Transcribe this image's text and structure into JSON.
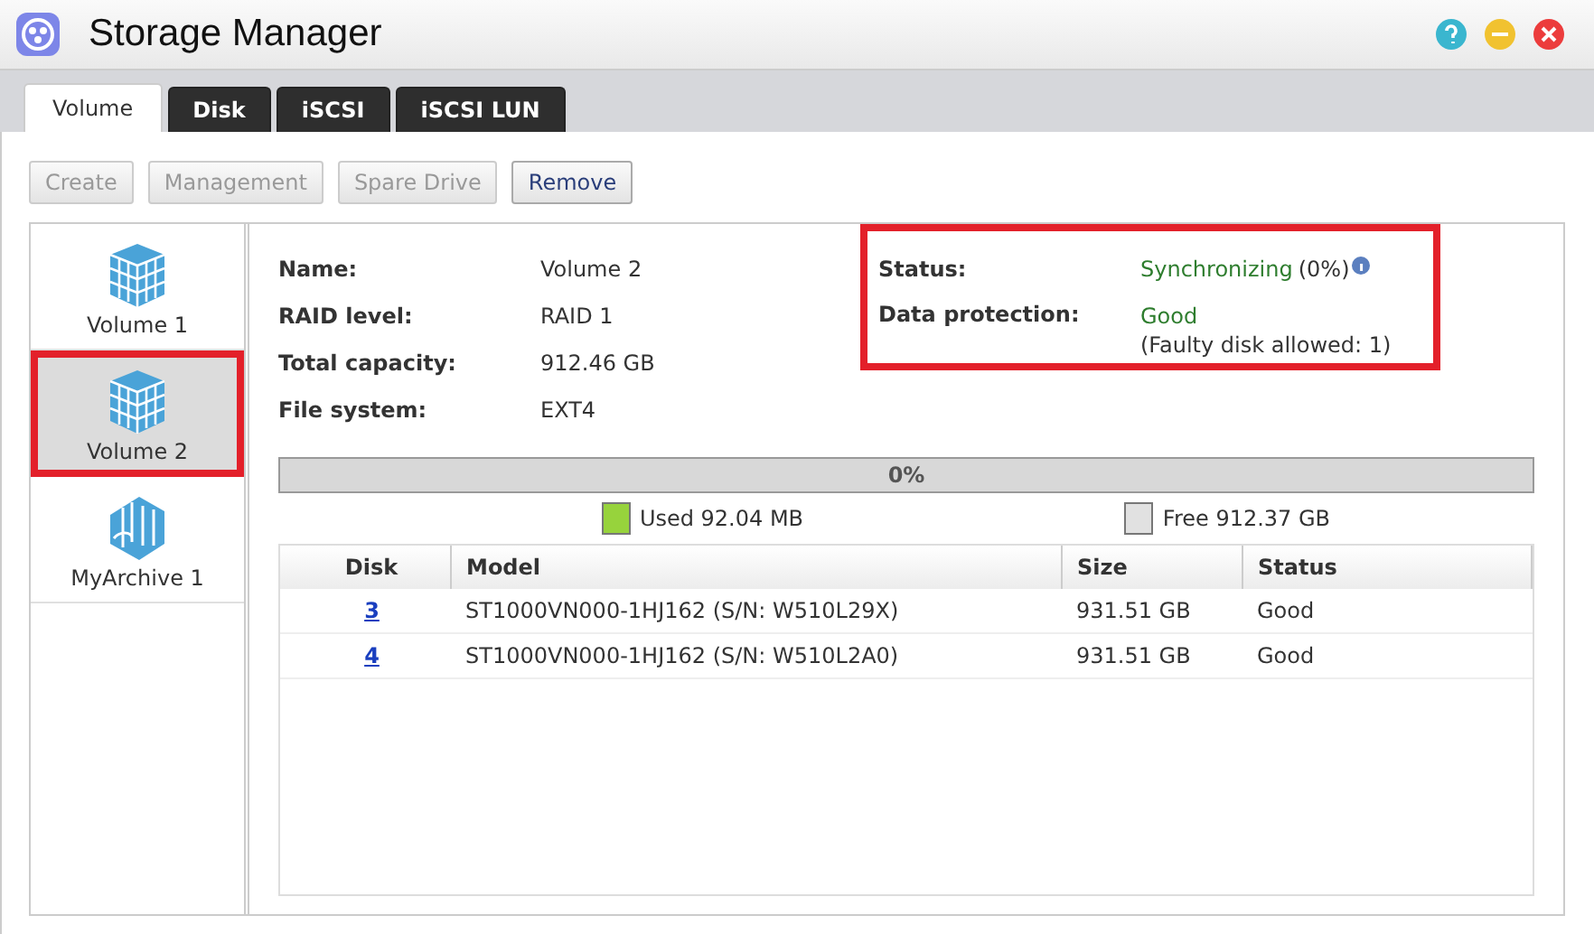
{
  "window": {
    "title": "Storage Manager"
  },
  "tabs": [
    {
      "label": "Volume",
      "selected": true
    },
    {
      "label": "Disk",
      "selected": false
    },
    {
      "label": "iSCSI",
      "selected": false
    },
    {
      "label": "iSCSI LUN",
      "selected": false
    }
  ],
  "toolbar": [
    {
      "label": "Create",
      "disabled": true
    },
    {
      "label": "Management",
      "disabled": true
    },
    {
      "label": "Spare Drive",
      "disabled": true
    },
    {
      "label": "Remove",
      "disabled": false
    }
  ],
  "sidebar": {
    "items": [
      {
        "label": "Volume 1",
        "kind": "volume",
        "selected": false,
        "highlighted": false
      },
      {
        "label": "Volume 2",
        "kind": "volume",
        "selected": true,
        "highlighted": true
      },
      {
        "label": "MyArchive 1",
        "kind": "archive",
        "selected": false,
        "highlighted": false
      }
    ]
  },
  "details": [
    {
      "label": "Name:",
      "value": "Volume 2"
    },
    {
      "label": "RAID level:",
      "value": "RAID 1"
    },
    {
      "label": "Total capacity:",
      "value": "912.46 GB"
    },
    {
      "label": "File system:",
      "value": "EXT4"
    }
  ],
  "status_panel": {
    "highlighted": true,
    "status_label": "Status:",
    "status": "Synchronizing",
    "status_progress": "(0%)",
    "protection_label": "Data protection:",
    "protection": "Good",
    "protection_note": "(Faulty disk allowed: 1)"
  },
  "usage": {
    "reading": "0%",
    "used": "Used 92.04 MB",
    "free": "Free 912.37 GB"
  },
  "table": {
    "columns": [
      "Disk",
      "Model",
      "Size",
      "Status"
    ],
    "rows": [
      [
        "3",
        "ST1000VN000-1HJ162 (S/N: W510L29X)",
        "931.51 GB",
        "Good"
      ],
      [
        "4",
        "ST1000VN000-1HJ162 (S/N: W510L2A0)",
        "931.51 GB",
        "Good"
      ]
    ]
  }
}
